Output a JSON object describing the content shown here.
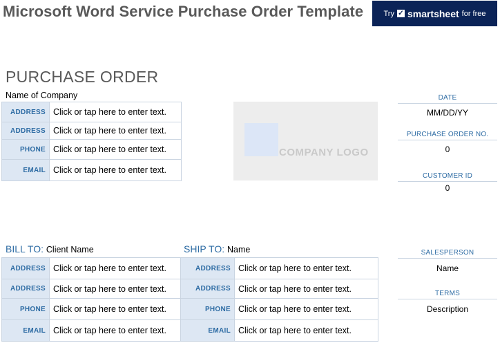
{
  "header": {
    "title": "Microsoft Word Service Purchase Order Template",
    "promo": {
      "try": "Try",
      "brand": "smartsheet",
      "free": "for free",
      "bg_color": "#0b2357"
    }
  },
  "po": {
    "heading": "PURCHASE ORDER",
    "company_name": "Name of Company",
    "company_rows": [
      {
        "label": "ADDRESS",
        "value": "Click or tap here to enter text."
      },
      {
        "label": "ADDRESS",
        "value": "Click or tap here to enter text."
      },
      {
        "label": "PHONE",
        "value": "Click or tap here to enter text."
      },
      {
        "label": "EMAIL",
        "value": "Click or tap here to enter text."
      }
    ],
    "logo_text": "COMPANY LOGO"
  },
  "meta": {
    "date_label": "DATE",
    "date_value": "MM/DD/YY",
    "po_no_label": "PURCHASE ORDER NO.",
    "po_no_value": "0",
    "customer_id_label": "CUSTOMER ID",
    "customer_id_value": "0",
    "salesperson_label": "SALESPERSON",
    "salesperson_value": "Name",
    "terms_label": "TERMS",
    "terms_value": "Description"
  },
  "bill_to": {
    "label": "BILL TO",
    "name": "Client Name",
    "rows": [
      {
        "label": "ADDRESS",
        "value": "Click or tap here to enter text."
      },
      {
        "label": "ADDRESS",
        "value": "Click or tap here to enter text."
      },
      {
        "label": "PHONE",
        "value": "Click or tap here to enter text."
      },
      {
        "label": "EMAIL",
        "value": "Click or tap here to enter text."
      }
    ]
  },
  "ship_to": {
    "label": "SHIP TO",
    "name": "Name",
    "rows": [
      {
        "label": "ADDRESS",
        "value": "Click or tap here to enter text."
      },
      {
        "label": "ADDRESS",
        "value": "Click or tap here to enter text."
      },
      {
        "label": "PHONE",
        "value": "Click or tap here to enter text."
      },
      {
        "label": "EMAIL",
        "value": "Click or tap here to enter text."
      }
    ]
  },
  "colors": {
    "accent": "#2e6ca4",
    "label_bg": "#dde7f3",
    "border": "#c9d4e1",
    "logo_bg": "#ededed",
    "title": "#595959"
  }
}
